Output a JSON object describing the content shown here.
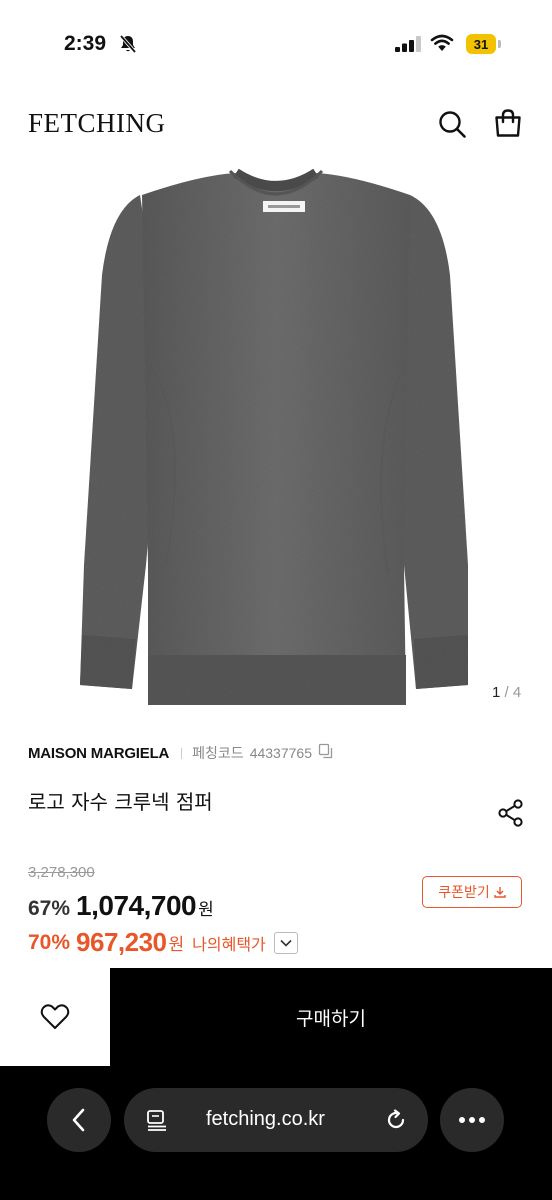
{
  "status_bar": {
    "time": "2:39",
    "battery": "31",
    "icons": [
      "bell-slash-icon",
      "signal-icon",
      "wifi-icon",
      "battery-icon"
    ]
  },
  "header": {
    "logo": "FETCHING",
    "icons": [
      "search-icon",
      "shopping-bag-icon"
    ]
  },
  "gallery": {
    "current": "1",
    "separator": "/",
    "total": "4",
    "image": "grey-sweater-image"
  },
  "product": {
    "brand": "MAISON MARGIELA",
    "code_label": "페칭코드",
    "code_value": "44337765",
    "name": "로고 자수 크루넥 점퍼"
  },
  "pricing": {
    "original_price": "3,278,300",
    "discount_pct": "67%",
    "price": "1,074,700",
    "currency": "원",
    "my_discount_pct": "70%",
    "my_price": "967,230",
    "my_currency": "원",
    "my_price_label": "나의혜택가",
    "coupon_label": "쿠폰받기",
    "accent_color": "#e8572a"
  },
  "purchase": {
    "buy_label": "구매하기"
  },
  "browser": {
    "url": "fetching.co.kr"
  }
}
